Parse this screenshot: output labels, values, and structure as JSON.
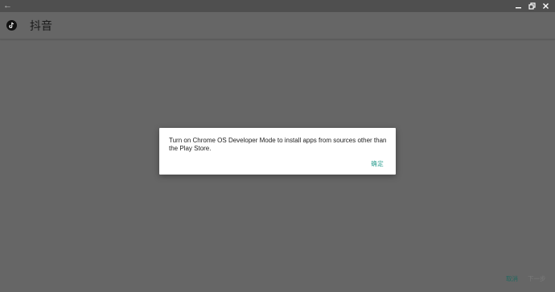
{
  "titlebar": {
    "back_icon": "back-arrow-icon",
    "controls": [
      "minimize-icon",
      "restore-icon",
      "close-icon"
    ]
  },
  "app": {
    "icon": "tiktok-logo-icon",
    "title": "抖音"
  },
  "dialog": {
    "message": "Turn on Chrome OS Developer Mode to install apps from sources other than the Play Store.",
    "ok_label": "确定"
  },
  "bottom": {
    "cancel_label": "取消",
    "next_label": "下一步"
  },
  "colors": {
    "overlay": "#666666",
    "titlebar": "#4f4f4f",
    "accent": "#2a9d8f"
  }
}
